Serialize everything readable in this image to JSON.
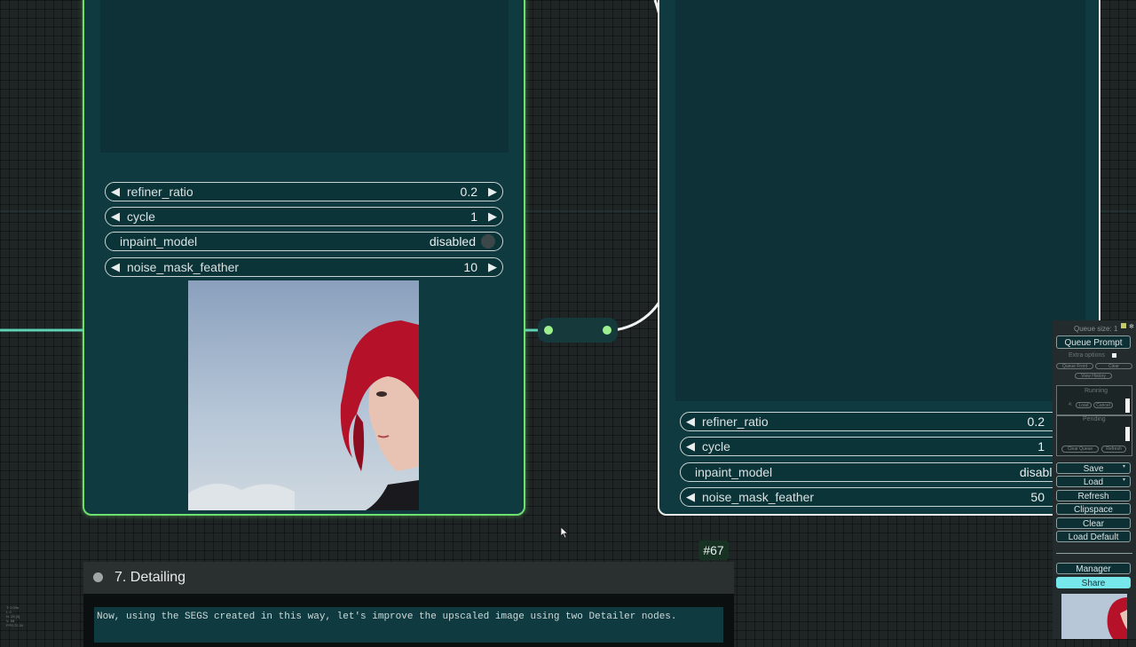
{
  "left_node": {
    "widgets": [
      {
        "label": "refiner_ratio",
        "value": "0.2"
      },
      {
        "label": "cycle",
        "value": "1"
      },
      {
        "label": "inpaint_model",
        "value": "disabled"
      },
      {
        "label": "noise_mask_feather",
        "value": "10"
      }
    ]
  },
  "right_node": {
    "widgets": [
      {
        "label": "refiner_ratio",
        "value": "0.2"
      },
      {
        "label": "cycle",
        "value": "1"
      },
      {
        "label": "inpaint_model",
        "value": "disabled"
      },
      {
        "label": "noise_mask_feather",
        "value": "50"
      }
    ]
  },
  "node_badge": "#67",
  "group": {
    "title": "7. Detailing",
    "note": "Now, using the SEGS created in this way, let's improve the upscaled image using two Detailer nodes."
  },
  "menu": {
    "queue_size": "Queue size: 1",
    "queue_prompt": "Queue Prompt",
    "extra_options": "Extra options",
    "queue_front": "Queue Front",
    "clear_small": "Clear",
    "view_history": "View History",
    "running": "Running",
    "running_item_num": "4:",
    "load_small": "Load",
    "cancel_small": "Cancel",
    "pending": "Pending",
    "clear_queue": "Clear Queue",
    "refresh_small": "Refresh",
    "save": "Save",
    "load": "Load",
    "refresh": "Refresh",
    "clipspace": "Clipspace",
    "clear": "Clear",
    "load_default": "Load Default",
    "manager": "Manager",
    "share": "Share"
  },
  "stats": [
    "T: 0.00s",
    "I: 0",
    "N: 25 [4]",
    "V: 58",
    "FPS:72.34"
  ],
  "colors": {
    "selected_border": "#6ee06e",
    "node_body": "#0f3a3f",
    "link": "#5fd1b4",
    "share_button": "#76e8ec"
  }
}
